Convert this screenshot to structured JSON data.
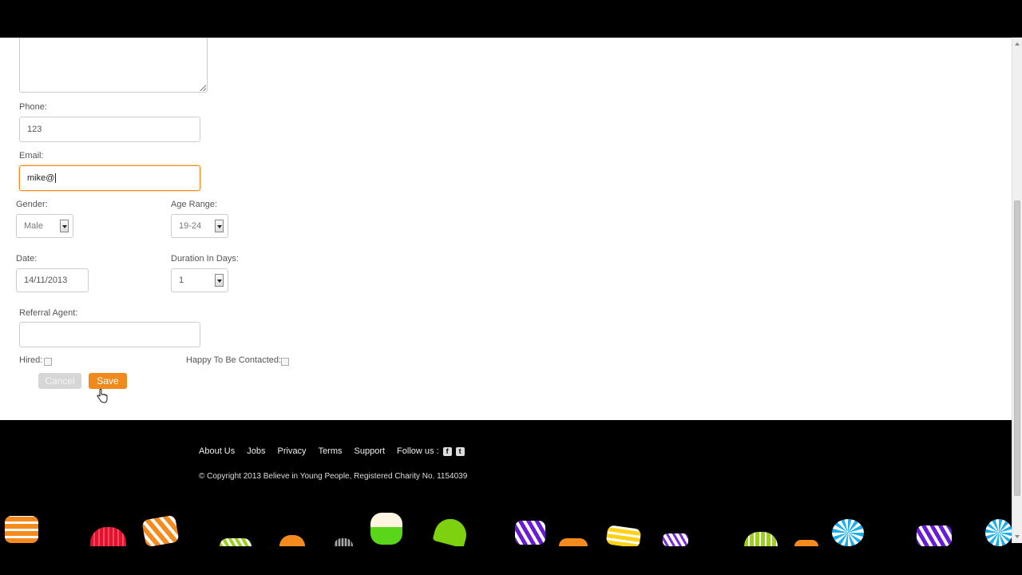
{
  "form": {
    "phone_label": "Phone:",
    "phone_value": "123",
    "email_label": "Email:",
    "email_value": "mike@",
    "gender_label": "Gender:",
    "gender_value": "Male",
    "age_label": "Age Range:",
    "age_value": "19-24",
    "date_label": "Date:",
    "date_value": "14/11/2013",
    "duration_label": "Duration In Days:",
    "duration_value": "1",
    "referral_label": "Referral Agent:",
    "referral_value": "",
    "hired_label": "Hired:",
    "contact_label": "Happy To Be Contacted:",
    "cancel_label": "Cancel",
    "save_label": "Save"
  },
  "footer": {
    "links": [
      "About Us",
      "Jobs",
      "Privacy",
      "Terms",
      "Support"
    ],
    "follow_label": "Follow us :",
    "facebook_icon": "f",
    "twitter_icon": "t",
    "copyright": "© Copyright 2013 Believe in Young People, Registered Charity No. 1154039"
  },
  "colors": {
    "accent": "#f08a1c",
    "footer_bg": "#000000"
  }
}
